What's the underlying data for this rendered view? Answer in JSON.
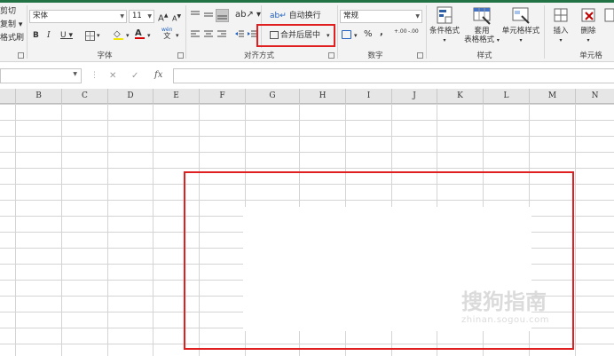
{
  "clipboard": {
    "cut": "剪切",
    "copy": "复制",
    "format_painter": "格式刷"
  },
  "font": {
    "name": "宋体",
    "size": "11",
    "grow": "A",
    "shrink": "A",
    "bold": "B",
    "italic": "I",
    "underline": "U",
    "font_color": "A",
    "wen": "wén",
    "wen_char": "文",
    "group_label": "字体"
  },
  "alignment": {
    "wrap_text": "自动换行",
    "merge_center": "合并后居中",
    "group_label": "对齐方式"
  },
  "number": {
    "format": "常规",
    "percent": "%",
    "comma": ",",
    "inc_decimal": "+.00",
    "dec_decimal": "-.00",
    "group_label": "数字"
  },
  "styles": {
    "conditional": "条件格式",
    "table_line1": "套用",
    "table_line2": "表格格式",
    "cell_styles": "单元格样式",
    "group_label": "样式"
  },
  "cells": {
    "insert": "插入",
    "delete": "删除",
    "group_label": "单元格"
  },
  "formula_bar": {
    "fx": "fx",
    "cancel": "✕",
    "confirm": "✓"
  },
  "columns": [
    "B",
    "C",
    "D",
    "E",
    "F",
    "G",
    "H",
    "I",
    "J",
    "K",
    "L",
    "M",
    "N"
  ],
  "watermark": {
    "main": "搜狗指南",
    "sub": "zhinan.sogou.com"
  }
}
